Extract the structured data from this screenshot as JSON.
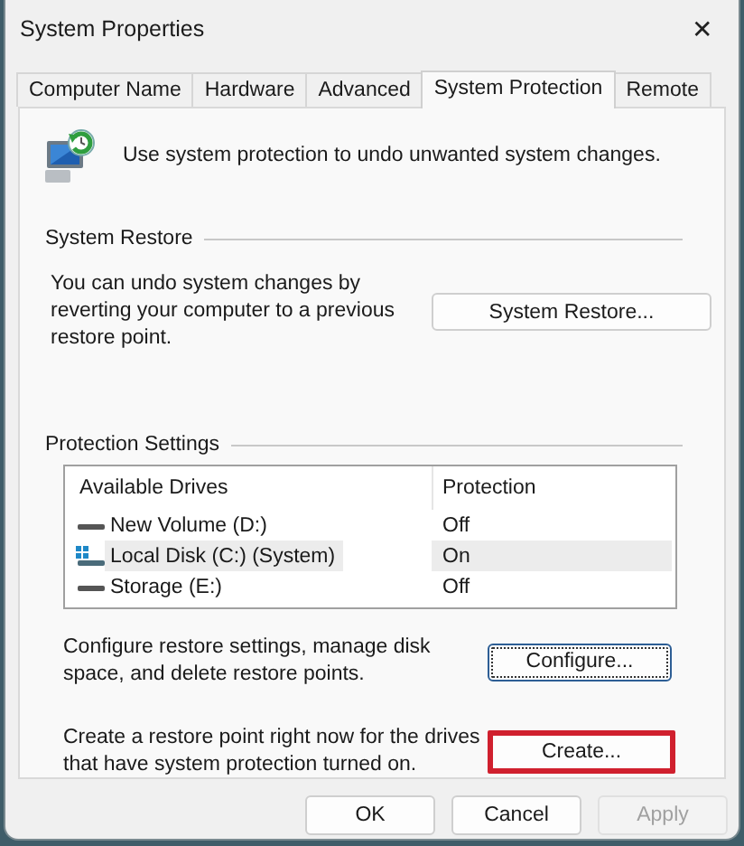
{
  "window": {
    "title": "System Properties",
    "close": "✕"
  },
  "tabs": [
    {
      "label": "Computer Name",
      "selected": false
    },
    {
      "label": "Hardware",
      "selected": false
    },
    {
      "label": "Advanced",
      "selected": false
    },
    {
      "label": "System Protection",
      "selected": true
    },
    {
      "label": "Remote",
      "selected": false
    }
  ],
  "intro": "Use system protection to undo unwanted system changes.",
  "system_restore": {
    "heading": "System Restore",
    "text": "You can undo system changes by reverting your computer to a previous restore point.",
    "button": {
      "label": "System Restore...",
      "focused": false,
      "highlighted": false
    }
  },
  "protection_settings": {
    "heading": "Protection Settings",
    "columns": [
      "Available Drives",
      "Protection"
    ],
    "drives": [
      {
        "name": "New Volume (D:)",
        "protection": "Off",
        "system": false,
        "selected": false
      },
      {
        "name": "Local Disk (C:) (System)",
        "protection": "On",
        "system": true,
        "selected": true
      },
      {
        "name": "Storage (E:)",
        "protection": "Off",
        "system": false,
        "selected": false
      }
    ],
    "configure": {
      "text": "Configure restore settings, manage disk space, and delete restore points.",
      "button": {
        "label": "Configure...",
        "focused": true,
        "highlighted": false
      }
    },
    "create": {
      "text": "Create a restore point right now for the drives that have system protection turned on.",
      "button": {
        "label": "Create...",
        "focused": false,
        "highlighted": true
      }
    }
  },
  "buttons": [
    {
      "label": "OK",
      "disabled": false
    },
    {
      "label": "Cancel",
      "disabled": false
    },
    {
      "label": "Apply",
      "disabled": true
    }
  ]
}
